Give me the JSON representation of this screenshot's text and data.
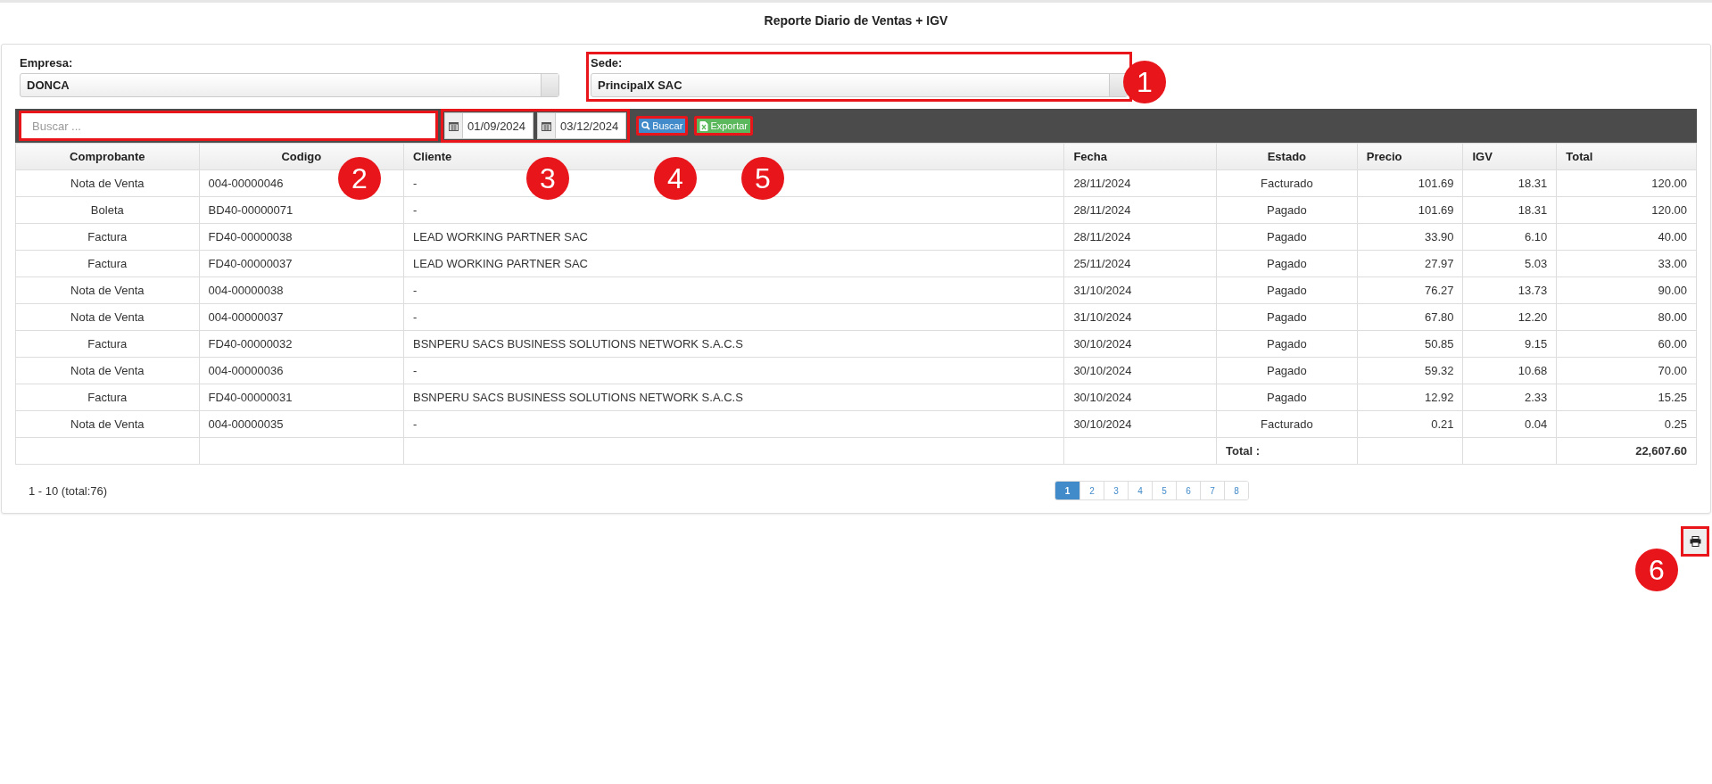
{
  "title": "Reporte Diario de Ventas + IGV",
  "filters": [
    {
      "label": "Empresa:",
      "value": "DONCA",
      "highlighted": false
    },
    {
      "label": "Sede:",
      "value": "PrincipalX SAC",
      "highlighted": true
    }
  ],
  "toolbar": {
    "search": {
      "placeholder": "Buscar ...",
      "highlighted": true
    },
    "dates": [
      {
        "value": "01/09/2024"
      },
      {
        "value": "03/12/2024"
      }
    ],
    "dates_highlighted": true,
    "buttons": [
      {
        "kind": "search",
        "label": "Buscar",
        "highlighted": true
      },
      {
        "kind": "export",
        "label": "Exportar",
        "highlighted": true
      }
    ]
  },
  "table": {
    "columns": [
      "Comprobante",
      "Codigo",
      "Cliente",
      "Fecha",
      "Estado",
      "Precio",
      "IGV",
      "Total"
    ],
    "rows": [
      [
        "Nota de Venta",
        "004-00000046",
        "-",
        "28/11/2024",
        "Facturado",
        "101.69",
        "18.31",
        "120.00"
      ],
      [
        "Boleta",
        "BD40-00000071",
        "-",
        "28/11/2024",
        "Pagado",
        "101.69",
        "18.31",
        "120.00"
      ],
      [
        "Factura",
        "FD40-00000038",
        "LEAD WORKING PARTNER SAC",
        "28/11/2024",
        "Pagado",
        "33.90",
        "6.10",
        "40.00"
      ],
      [
        "Factura",
        "FD40-00000037",
        "LEAD WORKING PARTNER SAC",
        "25/11/2024",
        "Pagado",
        "27.97",
        "5.03",
        "33.00"
      ],
      [
        "Nota de Venta",
        "004-00000038",
        "-",
        "31/10/2024",
        "Pagado",
        "76.27",
        "13.73",
        "90.00"
      ],
      [
        "Nota de Venta",
        "004-00000037",
        "-",
        "31/10/2024",
        "Pagado",
        "67.80",
        "12.20",
        "80.00"
      ],
      [
        "Factura",
        "FD40-00000032",
        "BSNPERU SACS BUSINESS SOLUTIONS NETWORK S.A.C.S",
        "30/10/2024",
        "Pagado",
        "50.85",
        "9.15",
        "60.00"
      ],
      [
        "Nota de Venta",
        "004-00000036",
        "-",
        "30/10/2024",
        "Pagado",
        "59.32",
        "10.68",
        "70.00"
      ],
      [
        "Factura",
        "FD40-00000031",
        "BSNPERU SACS BUSINESS SOLUTIONS NETWORK S.A.C.S",
        "30/10/2024",
        "Pagado",
        "12.92",
        "2.33",
        "15.25"
      ],
      [
        "Nota de Venta",
        "004-00000035",
        "-",
        "30/10/2024",
        "Facturado",
        "0.21",
        "0.04",
        "0.25"
      ]
    ],
    "total": {
      "label": "Total :",
      "value": "22,607.60"
    }
  },
  "summary": "1 - 10 (total:76)",
  "pages": [
    {
      "label": "1",
      "selected": true
    },
    {
      "label": "2",
      "selected": false
    },
    {
      "label": "3",
      "selected": false
    },
    {
      "label": "4",
      "selected": false
    },
    {
      "label": "5",
      "selected": false
    },
    {
      "label": "6",
      "selected": false
    },
    {
      "label": "7",
      "selected": false
    },
    {
      "label": "8",
      "selected": false
    }
  ],
  "print_button": {
    "highlighted": true
  },
  "callouts": [
    "1",
    "2",
    "3",
    "4",
    "5",
    "6"
  ]
}
